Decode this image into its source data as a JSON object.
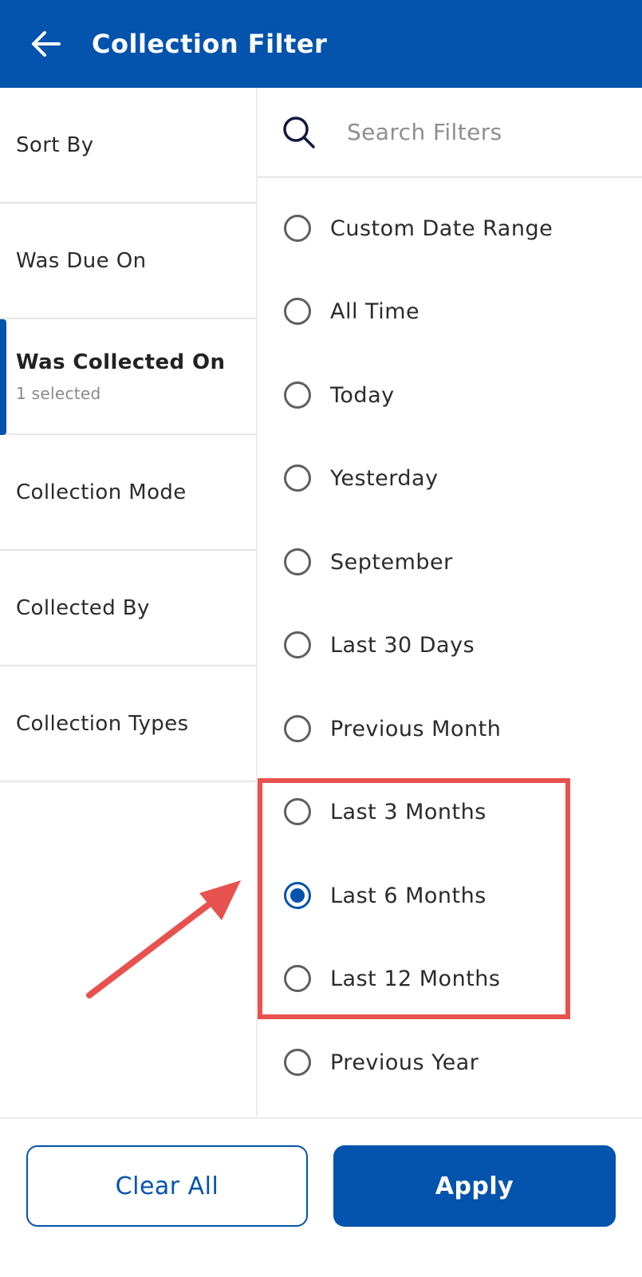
{
  "header": {
    "title": "Collection Filter",
    "back_icon": "arrow-left-icon",
    "background": "#0453ad"
  },
  "sidebar": {
    "items": [
      {
        "label": "Sort By",
        "sub": ""
      },
      {
        "label": "Was Due On",
        "sub": ""
      },
      {
        "label": "Was Collected On",
        "sub": "1 selected",
        "active": true
      },
      {
        "label": "Collection Mode",
        "sub": ""
      },
      {
        "label": "Collected By",
        "sub": ""
      },
      {
        "label": "Collection Types",
        "sub": ""
      }
    ]
  },
  "search": {
    "placeholder": "Search Filters",
    "value": "",
    "icon": "search-icon"
  },
  "options": [
    {
      "label": "Custom Date Range",
      "selected": false
    },
    {
      "label": "All Time",
      "selected": false
    },
    {
      "label": "Today",
      "selected": false
    },
    {
      "label": "Yesterday",
      "selected": false
    },
    {
      "label": "September",
      "selected": false
    },
    {
      "label": "Last 30 Days",
      "selected": false
    },
    {
      "label": "Previous Month",
      "selected": false
    },
    {
      "label": "Last 3 Months",
      "selected": false
    },
    {
      "label": "Last 6 Months",
      "selected": true
    },
    {
      "label": "Last 12 Months",
      "selected": false
    },
    {
      "label": "Previous Year",
      "selected": false
    }
  ],
  "annotation": {
    "highlight_color": "#e8524e"
  },
  "footer": {
    "clear_label": "Clear All",
    "apply_label": "Apply"
  }
}
